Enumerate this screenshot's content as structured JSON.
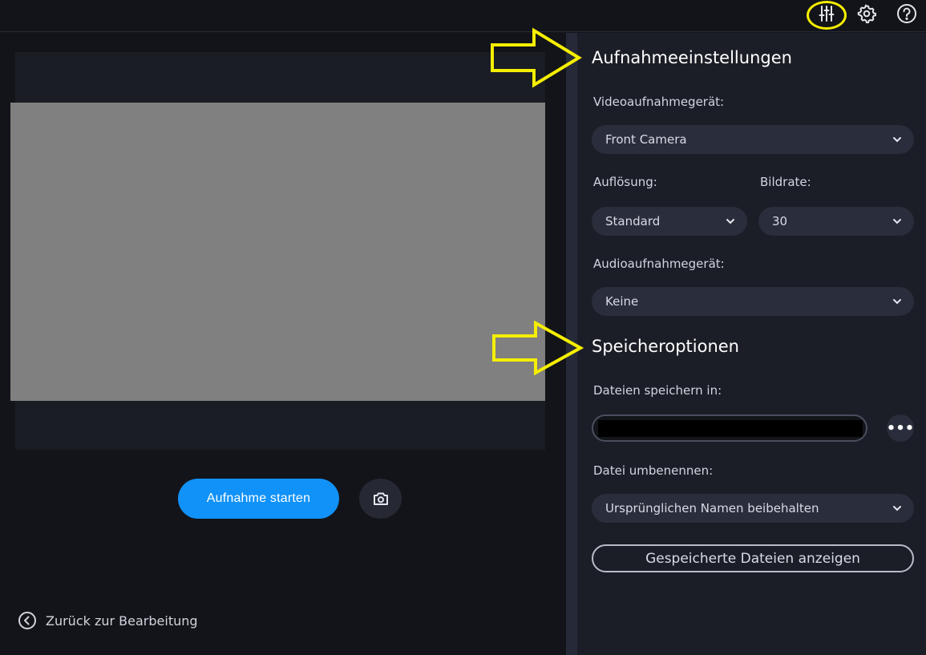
{
  "toolbar": {
    "icons": [
      "sliders-icon",
      "gear-icon",
      "help-icon"
    ],
    "highlight_color": "#f5ee00"
  },
  "left": {
    "start_button": "Aufnahme starten",
    "snapshot_icon": "camera-icon",
    "back_link": "Zurück zur Bearbeitung"
  },
  "recording_settings": {
    "heading": "Aufnahmeeinstellungen",
    "video_device_label": "Videoaufnahmegerät:",
    "video_device_value": "Front Camera",
    "resolution_label": "Auflösung:",
    "resolution_value": "Standard",
    "framerate_label": "Bildrate:",
    "framerate_value": "30",
    "audio_device_label": "Audioaufnahmegerät:",
    "audio_device_value": "Keine"
  },
  "save_options": {
    "heading": "Speicheroptionen",
    "save_in_label": "Dateien speichern in:",
    "save_path_value": "",
    "browse_label": "•••",
    "rename_label": "Datei umbenennen:",
    "rename_value": "Ursprünglichen Namen beibehalten",
    "show_files_button": "Gespeicherte Dateien anzeigen"
  },
  "colors": {
    "accent": "#1192f8",
    "panel": "#1c1e27",
    "background": "#131419",
    "annotation": "#f5ee00"
  }
}
